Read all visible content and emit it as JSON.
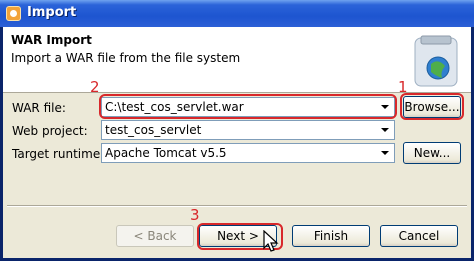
{
  "window": {
    "title": "Import"
  },
  "header": {
    "title": "WAR Import",
    "description": "Import a WAR file from the file system"
  },
  "form": {
    "war_file_label": "WAR file:",
    "war_file_value": "C:\\test_cos_servlet.war",
    "web_project_label": "Web project:",
    "web_project_value": "test_cos_servlet",
    "target_runtime_label": "Target runtime:",
    "target_runtime_value": "Apache Tomcat v5.5",
    "browse_label": "Browse...",
    "new_label": "New..."
  },
  "footer": {
    "back_label": "< Back",
    "next_label": "Next >",
    "finish_label": "Finish",
    "cancel_label": "Cancel"
  },
  "annotations": {
    "marker_1": "1",
    "marker_2": "2",
    "marker_3": "3",
    "color": "#d8282b"
  },
  "icons": {
    "title": "eclipse-icon",
    "header": "war-jar-icon",
    "pointer": "mouse-cursor-icon"
  }
}
